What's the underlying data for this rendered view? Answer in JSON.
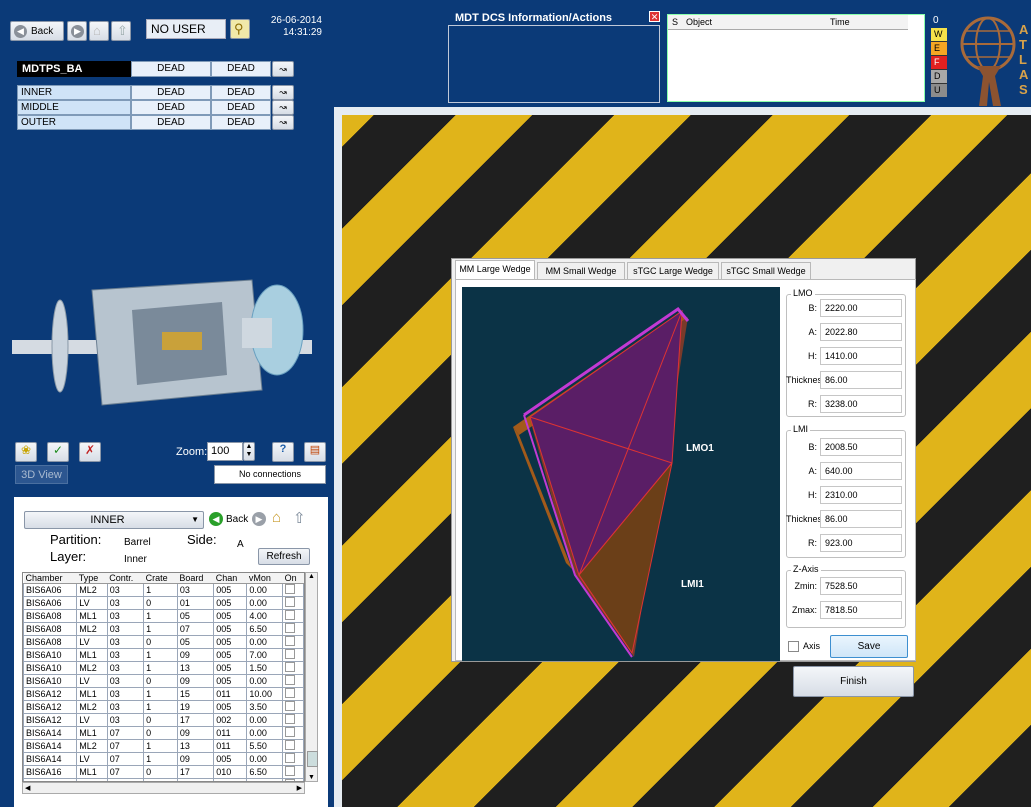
{
  "header": {
    "back_label": "Back",
    "user": "NO USER",
    "date": "26-06-2014",
    "time": "14:31:29",
    "info_title": "MDT DCS Information/Actions",
    "alarm_cols": [
      "S",
      "Object",
      "Time"
    ],
    "legend_count": "0",
    "legend": [
      {
        "key": "W",
        "color": "#f6e24a"
      },
      {
        "key": "E",
        "color": "#f5a623"
      },
      {
        "key": "F",
        "color": "#e02020"
      },
      {
        "key": "D",
        "color": "#a8a8a8"
      },
      {
        "key": "U",
        "color": "#8c8c8c"
      }
    ],
    "logo_letters": "ATLAS"
  },
  "status_panel": {
    "title": "MDTPS_BA",
    "title_cols": [
      "DEAD",
      "DEAD"
    ],
    "rows": [
      {
        "name": "INNER",
        "c1": "DEAD",
        "c2": "DEAD"
      },
      {
        "name": "MIDDLE",
        "c1": "DEAD",
        "c2": "DEAD"
      },
      {
        "name": "OUTER",
        "c1": "DEAD",
        "c2": "DEAD"
      }
    ]
  },
  "view_controls": {
    "zoom_label": "Zoom:",
    "zoom_value": "100",
    "view3d_label": "3D View",
    "connections": "No connections"
  },
  "chamber_panel": {
    "selector": "INNER",
    "back_label": "Back",
    "partition_label": "Partition:",
    "partition_value": "Barrel",
    "side_label": "Side:",
    "side_value": "A",
    "layer_label": "Layer:",
    "layer_value": "Inner",
    "refresh_label": "Refresh",
    "columns": [
      "Chamber",
      "Type",
      "Contr.",
      "Crate",
      "Board",
      "Chan",
      "vMon",
      "On"
    ],
    "rows": [
      [
        "BIS6A06",
        "ML2",
        "03",
        "1",
        "03",
        "005",
        "0.00"
      ],
      [
        "BIS6A06",
        "LV",
        "03",
        "0",
        "01",
        "005",
        "0.00"
      ],
      [
        "BIS6A08",
        "ML1",
        "03",
        "1",
        "05",
        "005",
        "4.00"
      ],
      [
        "BIS6A08",
        "ML2",
        "03",
        "1",
        "07",
        "005",
        "6.50"
      ],
      [
        "BIS6A08",
        "LV",
        "03",
        "0",
        "05",
        "005",
        "0.00"
      ],
      [
        "BIS6A10",
        "ML1",
        "03",
        "1",
        "09",
        "005",
        "7.00"
      ],
      [
        "BIS6A10",
        "ML2",
        "03",
        "1",
        "13",
        "005",
        "1.50"
      ],
      [
        "BIS6A10",
        "LV",
        "03",
        "0",
        "09",
        "005",
        "0.00"
      ],
      [
        "BIS6A12",
        "ML1",
        "03",
        "1",
        "15",
        "011",
        "10.00"
      ],
      [
        "BIS6A12",
        "ML2",
        "03",
        "1",
        "19",
        "005",
        "3.50"
      ],
      [
        "BIS6A12",
        "LV",
        "03",
        "0",
        "17",
        "002",
        "0.00"
      ],
      [
        "BIS6A14",
        "ML1",
        "07",
        "0",
        "09",
        "011",
        "0.00"
      ],
      [
        "BIS6A14",
        "ML2",
        "07",
        "1",
        "13",
        "011",
        "5.50"
      ],
      [
        "BIS6A14",
        "LV",
        "07",
        "1",
        "09",
        "005",
        "0.00"
      ],
      [
        "BIS6A16",
        "ML1",
        "07",
        "0",
        "17",
        "010",
        "6.50"
      ],
      [
        "BIS6A16",
        "ML2",
        "07",
        "0",
        "19",
        "011",
        "1.50"
      ],
      [
        "BIS6A16",
        "LV",
        "07",
        "1",
        "17",
        "002",
        "0.00"
      ]
    ]
  },
  "wedge_dialog": {
    "tabs": [
      "MM Large Wedge",
      "MM Small Wedge",
      "sTGC Large Wedge",
      "sTGC Small Wedge"
    ],
    "active_tab": 0,
    "viewport_labels": {
      "lmo": "LMO1",
      "lmi": "LMI1"
    },
    "lmo": {
      "title": "LMO",
      "B": "2220.00",
      "A": "2022.80",
      "H": "1410.00",
      "Thickness": "86.00",
      "R": "3238.00"
    },
    "lmi": {
      "title": "LMI",
      "B": "2008.50",
      "A": "640.00",
      "H": "2310.00",
      "Thickness": "86.00",
      "R": "923.00"
    },
    "zaxis": {
      "title": "Z-Axis",
      "Zmin": "7528.50",
      "Zmax": "7818.50"
    },
    "field_labels": {
      "B": "B:",
      "A": "A:",
      "H": "H:",
      "Thickness": "Thickness:",
      "R": "R:",
      "Zmin": "Zmin:",
      "Zmax": "Zmax:"
    },
    "axis_label": "Axis",
    "save_label": "Save",
    "finish_label": "Finish"
  }
}
